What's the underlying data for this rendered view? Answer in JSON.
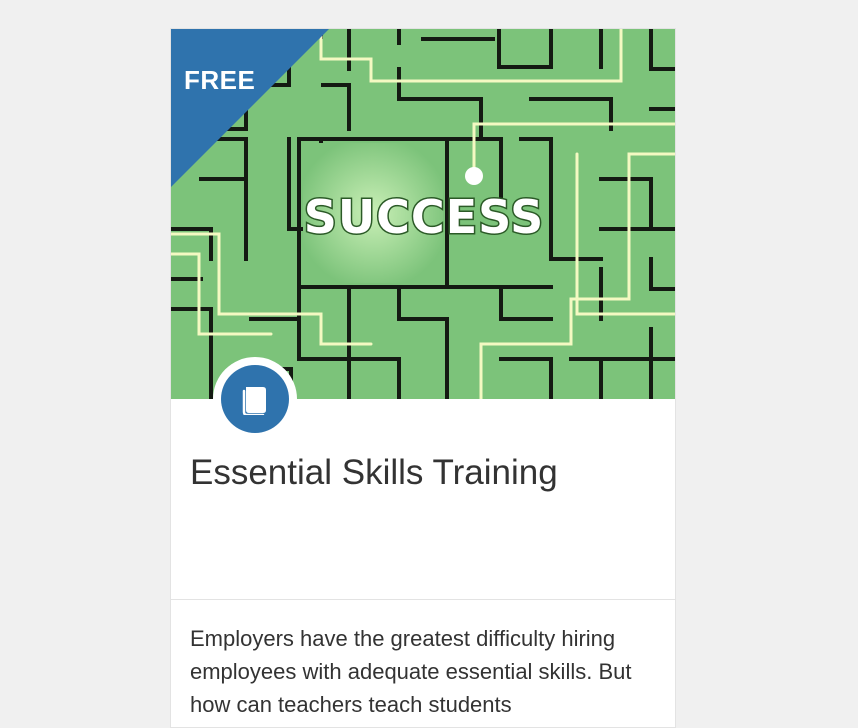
{
  "course_card": {
    "badge_label": "FREE",
    "image_text": "SUCCESS",
    "image_icon": "maze-illustration",
    "type_icon": "book-icon",
    "title": "Essential Skills Training",
    "description": "Employers have the greatest difficulty hiring employees with adequate essential skills. But how can teachers teach students"
  },
  "colors": {
    "background": "#f0f0f0",
    "card": "#ffffff",
    "accent": "#2f73ad",
    "maze_green": "#7cc37a",
    "text": "#333333"
  }
}
